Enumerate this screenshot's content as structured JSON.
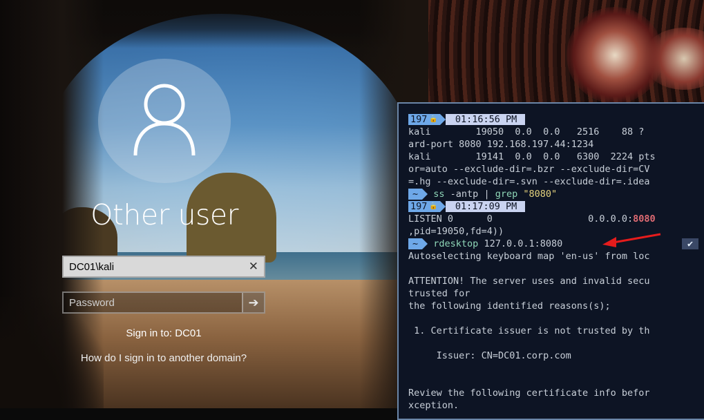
{
  "lockscreen": {
    "username": "Other user",
    "user_field_value": "DC01\\kali",
    "password_placeholder": "Password",
    "sign_in_to": "Sign in to: DC01",
    "another_domain_link": "How do I sign in to another domain?"
  },
  "terminal": {
    "lines": [
      {
        "type": "prompt-time",
        "num": "197",
        "time": "01:16:56 PM"
      },
      {
        "type": "text",
        "text": "kali        19050  0.0  0.0   2516    88 ?"
      },
      {
        "type": "text",
        "text": "ard-port 8080 192.168.197.44:1234"
      },
      {
        "type": "text",
        "text": "kali        19141  0.0  0.0   6300  2224 pts"
      },
      {
        "type": "text",
        "text": "or=auto --exclude-dir=.bzr --exclude-dir=CV"
      },
      {
        "type": "text",
        "text": "=.hg --exclude-dir=.svn --exclude-dir=.idea"
      },
      {
        "type": "prompt-cmd",
        "tilde": "~",
        "cmd": "ss",
        "args": " -antp | ",
        "cmd2": "grep",
        "str": " \"8080\""
      },
      {
        "type": "prompt-time",
        "num": "197",
        "time": "01:17:09 PM"
      },
      {
        "type": "listen",
        "text": "LISTEN 0      0                 0.0.0.0:",
        "port": "8080"
      },
      {
        "type": "text",
        "text": ",pid=19050,fd=4))"
      },
      {
        "type": "prompt-cmd2",
        "tilde": "~",
        "cmd": "rdesktop",
        "args": " 127.0.0.1:8080",
        "check": "✔"
      },
      {
        "type": "text",
        "text": "Autoselecting keyboard map 'en-us' from loc"
      },
      {
        "type": "text",
        "text": ""
      },
      {
        "type": "text",
        "text": "ATTENTION! The server uses and invalid secu"
      },
      {
        "type": "text",
        "text": "trusted for"
      },
      {
        "type": "text",
        "text": "the following identified reasons(s);"
      },
      {
        "type": "text",
        "text": ""
      },
      {
        "type": "text",
        "text": " 1. Certificate issuer is not trusted by th"
      },
      {
        "type": "text",
        "text": ""
      },
      {
        "type": "text",
        "text": "     Issuer: CN=DC01.corp.com"
      },
      {
        "type": "text",
        "text": ""
      },
      {
        "type": "text",
        "text": ""
      },
      {
        "type": "text",
        "text": "Review the following certificate info befor"
      },
      {
        "type": "text",
        "text": "xception."
      }
    ]
  },
  "icons": {
    "avatar": "user-silhouette-icon",
    "clear": "clear-x-icon",
    "submit": "arrow-right-icon",
    "lock": "lock-icon",
    "annotation": "red-arrow-annotation"
  },
  "colors": {
    "terminal_bg": "#0d1424",
    "prompt_blue": "#6ea8e8",
    "prompt_light": "#c9d3f0",
    "port_red": "#e06b73",
    "cmd_green": "#8fd7b8",
    "string_yellow": "#e6d47e"
  }
}
